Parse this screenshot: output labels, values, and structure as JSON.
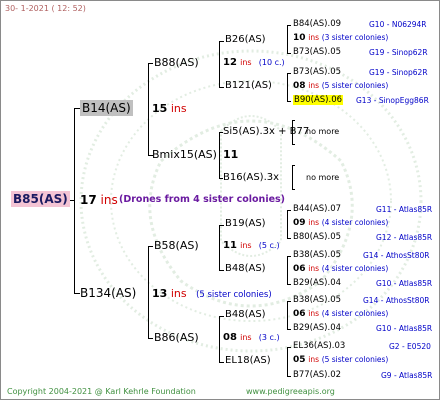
{
  "header": {
    "date_text": "30-   1-2021  ( 12:  52)"
  },
  "footer": {
    "copyright": "Copyright 2004-2021 @ Karl Kehrle Foundation",
    "website": "www.pedigreeapis.org"
  },
  "root": {
    "label": "B85(AS)",
    "count": "17",
    "ins": "ins",
    "drones": "(Drones from 4 sister colonies)"
  },
  "level1": {
    "top": {
      "label": "B14(AS)",
      "count": "15",
      "ins": "ins"
    },
    "bottom": {
      "label": "B134(AS)",
      "count": "13",
      "ins": "ins",
      "note": "(5 sister colonies)"
    }
  },
  "level2": {
    "b88": {
      "label": "B88(AS)"
    },
    "bmix": {
      "label": "Bmix15(AS)",
      "count": "11"
    },
    "b58": {
      "label": "B58(AS)"
    },
    "b86": {
      "label": "B86(AS)"
    }
  },
  "level3": {
    "b26": {
      "label": "B26(AS)",
      "count": "12",
      "ins": "ins",
      "note": "(10 c.)"
    },
    "b121": {
      "label": "B121(AS)"
    },
    "si5": {
      "label": "Si5(AS).3x + B77"
    },
    "b16": {
      "label": "B16(AS).3x"
    },
    "b19": {
      "label": "B19(AS)",
      "count": "11",
      "ins": "ins",
      "note": "(5 c.)"
    },
    "b48a": {
      "label": "B48(AS)"
    },
    "b48b": {
      "label": "B48(AS)",
      "count": "08",
      "ins": "ins",
      "note": "(3 c.)"
    },
    "el18": {
      "label": "EL18(AS)"
    }
  },
  "ancestors": [
    {
      "label": "B84(AS).09",
      "code": "G10 - N06294R"
    },
    {
      "count": "10",
      "ins": "ins",
      "note": "(3 sister colonies)"
    },
    {
      "label": "B73(AS).05",
      "code": "G19 - Sinop62R"
    },
    {
      "label": "B73(AS).05",
      "code": "G19 - Sinop62R"
    },
    {
      "count": "08",
      "ins": "ins",
      "note": "(5 sister colonies)"
    },
    {
      "label": "B90(AS).06",
      "code": "G13 - SinopEgg86R"
    },
    {
      "label": "no more"
    },
    {
      "label": "no more"
    },
    {
      "label": "B44(AS).07",
      "code": "G11 - Atlas85R"
    },
    {
      "count": "09",
      "ins": "ins",
      "note": "(4 sister colonies)"
    },
    {
      "label": "B80(AS).05",
      "code": "G12 - Atlas85R"
    },
    {
      "label": "B38(AS).05",
      "code": "G14 - AthosSt80R"
    },
    {
      "count": "06",
      "ins": "ins",
      "note": "(4 sister colonies)"
    },
    {
      "label": "B29(AS).04",
      "code": "G10 - Atlas85R"
    },
    {
      "label": "B38(AS).05",
      "code": "G14 - AthosSt80R"
    },
    {
      "count": "06",
      "ins": "ins",
      "note": "(4 sister colonies)"
    },
    {
      "label": "B29(AS).04",
      "code": "G10 - Atlas85R"
    },
    {
      "label": "EL36(AS).03",
      "code": "G2 - E0520"
    },
    {
      "count": "05",
      "ins": "ins",
      "note": "(5 sister colonies)"
    },
    {
      "label": "B77(AS).02",
      "code": "G9 - Atlas85R"
    }
  ]
}
